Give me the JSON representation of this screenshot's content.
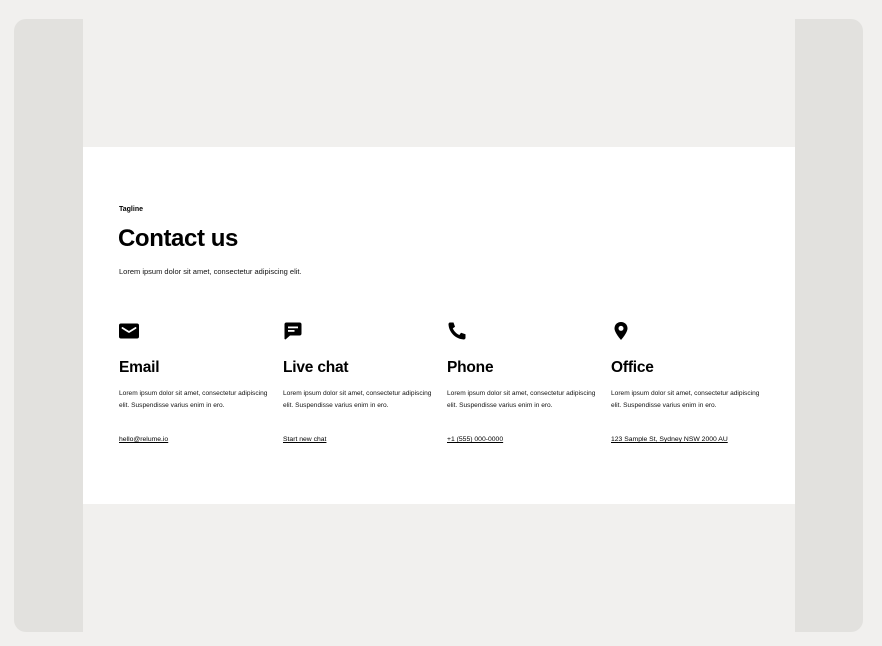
{
  "contact": {
    "tagline": "Tagline",
    "title": "Contact us",
    "subtitle": "Lorem ipsum dolor sit amet, consectetur adipiscing elit.",
    "cards": [
      {
        "icon": "envelope-icon",
        "title": "Email",
        "description": "Lorem ipsum dolor sit amet, consectetur adipiscing elit. Suspendisse varius enim in ero.",
        "link": "hello@relume.io"
      },
      {
        "icon": "chat-bubble-icon",
        "title": "Live chat",
        "description": "Lorem ipsum dolor sit amet, consectetur adipiscing elit. Suspendisse varius enim in ero.",
        "link": "Start new chat"
      },
      {
        "icon": "phone-icon",
        "title": "Phone",
        "description": "Lorem ipsum dolor sit amet, consectetur adipiscing elit. Suspendisse varius enim in ero.",
        "link": "+1 (555) 000-0000"
      },
      {
        "icon": "map-pin-icon",
        "title": "Office",
        "description": "Lorem ipsum dolor sit amet, consectetur adipiscing elit. Suspendisse varius enim in ero.",
        "link": "123 Sample St, Sydney NSW 2000 AU"
      }
    ]
  },
  "colors": {
    "page_background": "#f1f0ee",
    "frame_background": "#e2e1de",
    "section_background": "#ffffff",
    "text": "#000000"
  }
}
